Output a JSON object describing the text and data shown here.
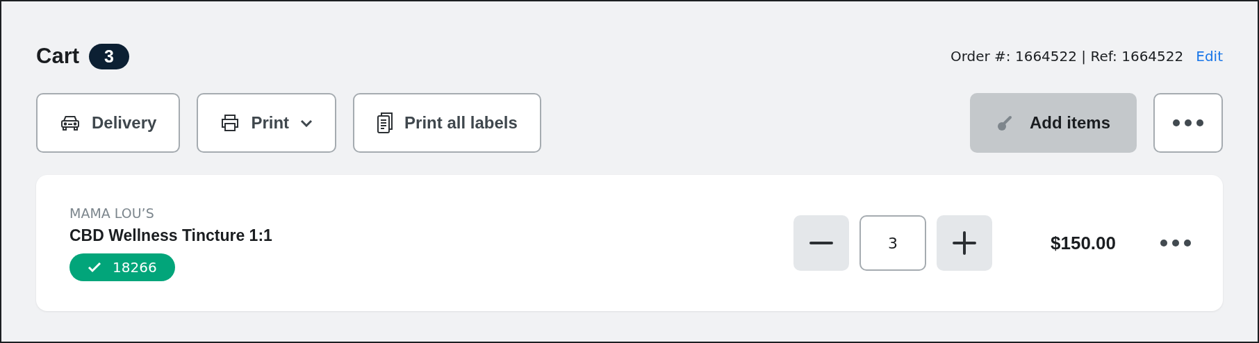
{
  "header": {
    "title": "Cart",
    "count": "3",
    "order_info": "Order #: 1664522 | Ref: 1664522",
    "edit_link": "Edit"
  },
  "toolbar_left": [
    {
      "kind": "car",
      "label": "Delivery",
      "dropdown": false
    },
    {
      "kind": "printer",
      "label": "Print",
      "dropdown": true
    },
    {
      "kind": "documents",
      "label": "Print all labels",
      "dropdown": false
    }
  ],
  "add_items": {
    "label": "Add items",
    "hovered": true
  },
  "cart_items": [
    {
      "brand": "MAMA LOU’S",
      "name": "CBD Wellness Tincture 1:1",
      "tag": {
        "label": "18266",
        "verified": true
      },
      "quantity": "3",
      "price": "$150.00"
    }
  ]
}
